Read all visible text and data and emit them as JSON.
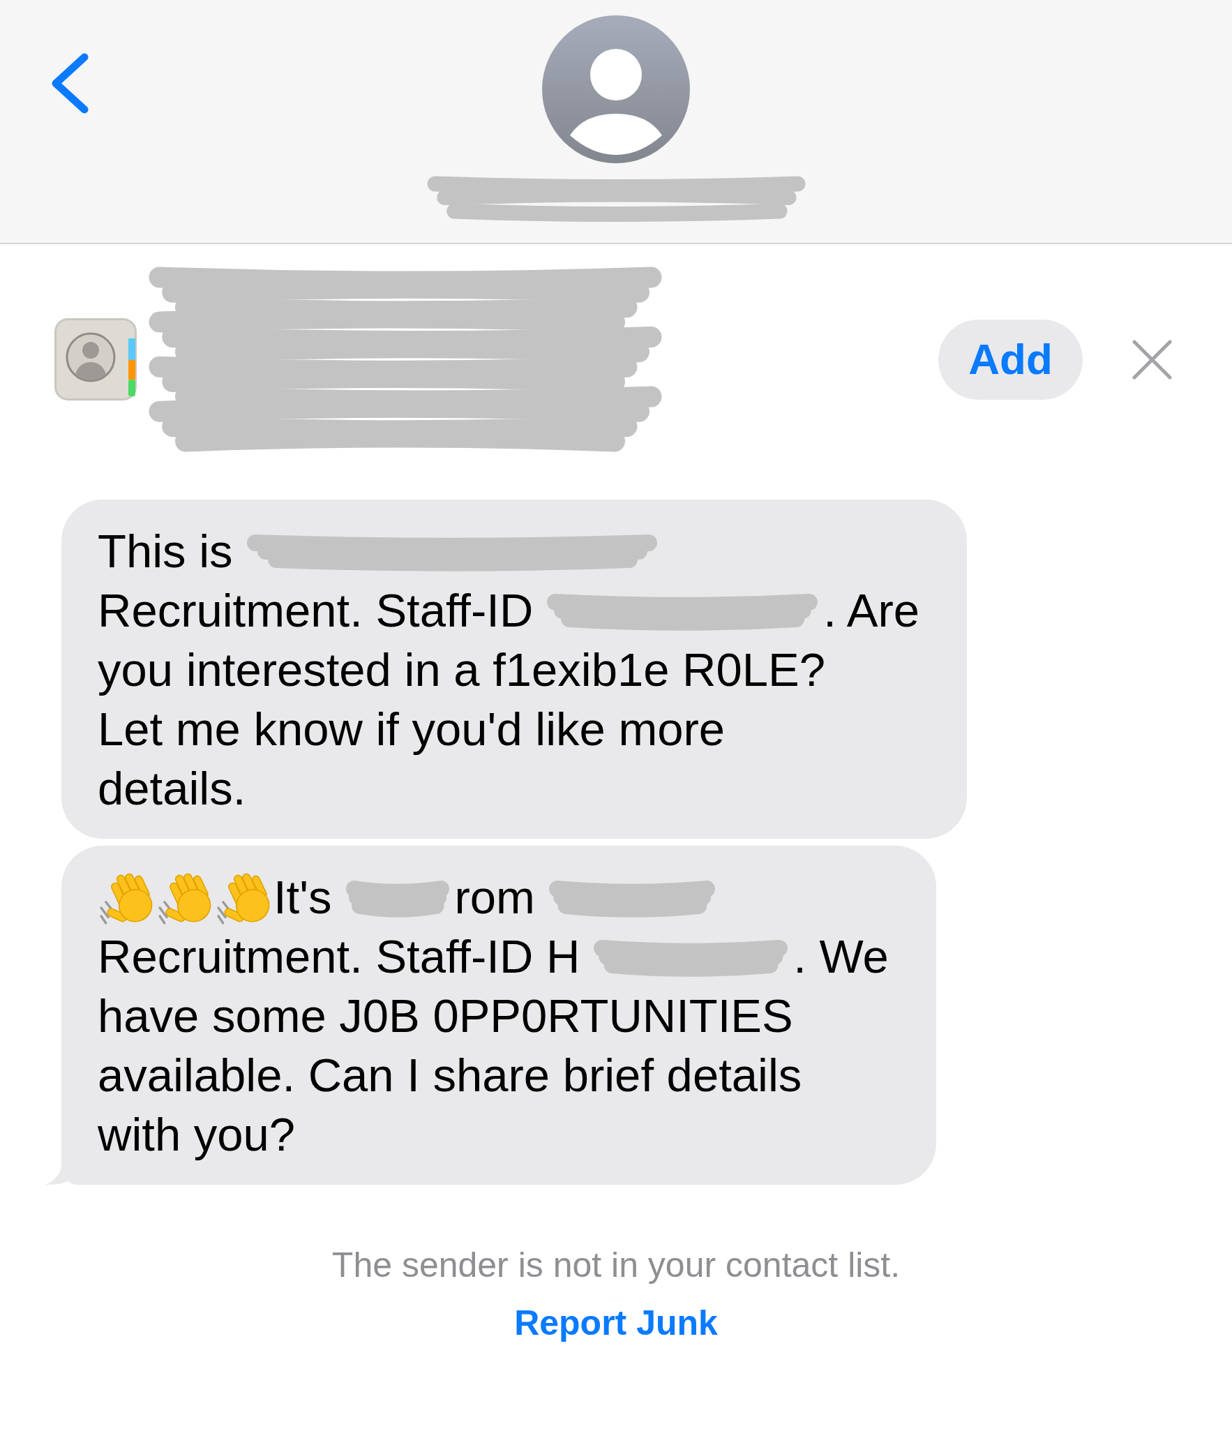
{
  "contact_banner": {
    "add_label": "Add"
  },
  "messages": [
    {
      "tail": false,
      "lines": [
        [
          {
            "kind": "text",
            "text": "This is"
          },
          {
            "kind": "redaction"
          }
        ],
        [
          {
            "kind": "text",
            "text": "Recruitment. Staff-ID"
          },
          {
            "kind": "redaction"
          },
          {
            "kind": "text",
            "text": ". Are"
          }
        ],
        [
          {
            "kind": "text",
            "text": "you interested in a f1exib1e R0LE?"
          }
        ],
        [
          {
            "kind": "text",
            "text": "Let me know if you'd like more"
          }
        ],
        [
          {
            "kind": "text",
            "text": "details."
          }
        ]
      ]
    },
    {
      "tail": true,
      "lines": [
        [
          {
            "kind": "emoji"
          },
          {
            "kind": "emoji"
          },
          {
            "kind": "emoji"
          },
          {
            "kind": "text",
            "text": "It's"
          },
          {
            "kind": "redaction"
          },
          {
            "kind": "text",
            "text": "rom"
          },
          {
            "kind": "redaction"
          }
        ],
        [
          {
            "kind": "text",
            "text": "Recruitment. Staff-ID H"
          },
          {
            "kind": "redaction"
          },
          {
            "kind": "text",
            "text": ". We"
          }
        ],
        [
          {
            "kind": "text",
            "text": "have some J0B 0PP0RTUNITIES"
          }
        ],
        [
          {
            "kind": "text",
            "text": "available. Can I share brief details"
          }
        ],
        [
          {
            "kind": "text",
            "text": "with you?"
          }
        ]
      ]
    }
  ],
  "footer": {
    "notice": "The sender is not in your contact list.",
    "link": "Report Junk"
  }
}
